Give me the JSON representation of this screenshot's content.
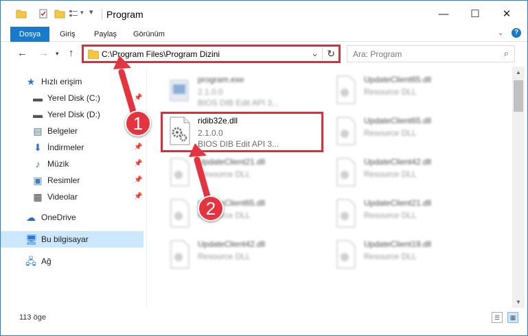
{
  "window": {
    "title": "Program"
  },
  "ribbon": {
    "tabs": [
      {
        "label": "Dosya",
        "active": true
      },
      {
        "label": "Giriş"
      },
      {
        "label": "Paylaş"
      },
      {
        "label": "Görünüm"
      }
    ]
  },
  "address": {
    "path": "C:\\Program Files\\Program Dizini"
  },
  "search": {
    "placeholder": "Ara: Program"
  },
  "sidebar": {
    "items": [
      {
        "label": "Hızlı erişim",
        "icon": "star-icon"
      },
      {
        "label": "Yerel Disk (C:)",
        "icon": "drive-icon",
        "pinned": true
      },
      {
        "label": "Yerel Disk (D:)",
        "icon": "drive-icon",
        "pinned": false
      },
      {
        "label": "Belgeler",
        "icon": "documents-icon",
        "pinned": false
      },
      {
        "label": "İndirmeler",
        "icon": "download-icon",
        "pinned": true
      },
      {
        "label": "Müzik",
        "icon": "music-icon",
        "pinned": true
      },
      {
        "label": "Resimler",
        "icon": "pictures-icon",
        "pinned": true
      },
      {
        "label": "Videolar",
        "icon": "videos-icon",
        "pinned": true
      },
      {
        "label": "OneDrive",
        "icon": "cloud-icon"
      },
      {
        "label": "Bu bilgisayar",
        "icon": "computer-icon",
        "selected": true
      },
      {
        "label": "Ağ",
        "icon": "network-icon"
      }
    ]
  },
  "files": [
    {
      "name": "program.exe",
      "line2": "2.1.0.0",
      "line3": "BIOS DIB Edit API 3...",
      "blurred": true
    },
    {
      "name": "UpdateClient65.dll",
      "line2": "Resource DLL",
      "blurred": true
    },
    {
      "name": "ridib32e.dll",
      "line2": "2.1.0.0",
      "line3": "BIOS DIB Edit API 3...",
      "blurred": false
    },
    {
      "name": "UpdateClient65.dll",
      "line2": "Resource DLL",
      "blurred": true
    },
    {
      "name": "UpdateClient21.dll",
      "line2": "Resource DLL",
      "blurred": true
    },
    {
      "name": "UpdateClient42.dll",
      "line2": "Resource DLL",
      "blurred": true
    },
    {
      "name": "UpdateClient65.dll",
      "line2": "Resource DLL",
      "blurred": true
    },
    {
      "name": "UpdateClient21.dll",
      "line2": "Resource DLL",
      "blurred": true
    },
    {
      "name": "UpdateClient42.dll",
      "line2": "Resource DLL",
      "blurred": true
    },
    {
      "name": "UpdateClient19.dll",
      "line2": "Resource DLL",
      "blurred": true
    }
  ],
  "status": {
    "item_count": "113 öge"
  },
  "callouts": {
    "one": "1",
    "two": "2"
  },
  "colors": {
    "accent": "#1979ca",
    "highlight": "#d6303c",
    "callout": "#e3343f",
    "selected": "#cce8ff"
  }
}
